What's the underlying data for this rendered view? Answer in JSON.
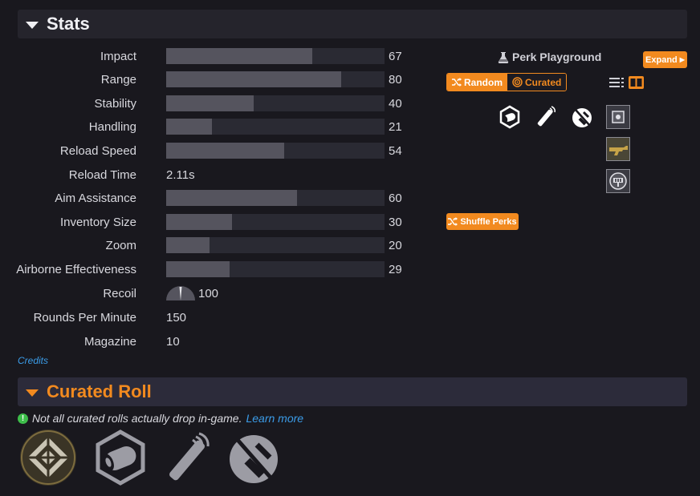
{
  "stats_section": {
    "title": "Stats"
  },
  "stats": [
    {
      "label": "Impact",
      "value": "67",
      "bar": 67
    },
    {
      "label": "Range",
      "value": "80",
      "bar": 80
    },
    {
      "label": "Stability",
      "value": "40",
      "bar": 40
    },
    {
      "label": "Handling",
      "value": "21",
      "bar": 21
    },
    {
      "label": "Reload Speed",
      "value": "54",
      "bar": 54
    },
    {
      "label": "Reload Time",
      "value": "2.11s"
    },
    {
      "label": "Aim Assistance",
      "value": "60",
      "bar": 60
    },
    {
      "label": "Inventory Size",
      "value": "30",
      "bar": 30
    },
    {
      "label": "Zoom",
      "value": "20",
      "bar": 20
    },
    {
      "label": "Airborne Effectiveness",
      "value": "29",
      "bar": 29
    },
    {
      "label": "Recoil",
      "value": "100"
    },
    {
      "label": "Rounds Per Minute",
      "value": "150"
    },
    {
      "label": "Magazine",
      "value": "10"
    }
  ],
  "credits": "Credits",
  "perk_playground": {
    "title": "Perk Playground",
    "expand_label": "Expand",
    "mode_random": "Random",
    "mode_curated": "Curated",
    "shuffle_label": "Shuffle Perks",
    "perk_icons": [
      "barrel-icon",
      "magazine-icon",
      "trait-icon",
      "mod-icon",
      "weapon-skin-icon",
      "tracker-icon"
    ]
  },
  "curated_section": {
    "title": "Curated Roll",
    "note": "Not all curated rolls actually drop in-game.",
    "learn_more": "Learn more",
    "perk_icons": [
      "intrinsic-frame-icon",
      "barrel-icon",
      "magazine-icon",
      "trait-icon"
    ]
  },
  "colors": {
    "accent": "#f28a1f",
    "link": "#3b9ce8",
    "bar_fill": "#55545e",
    "bar_track": "#2a2a33",
    "info_dot": "#3dbd4a"
  }
}
